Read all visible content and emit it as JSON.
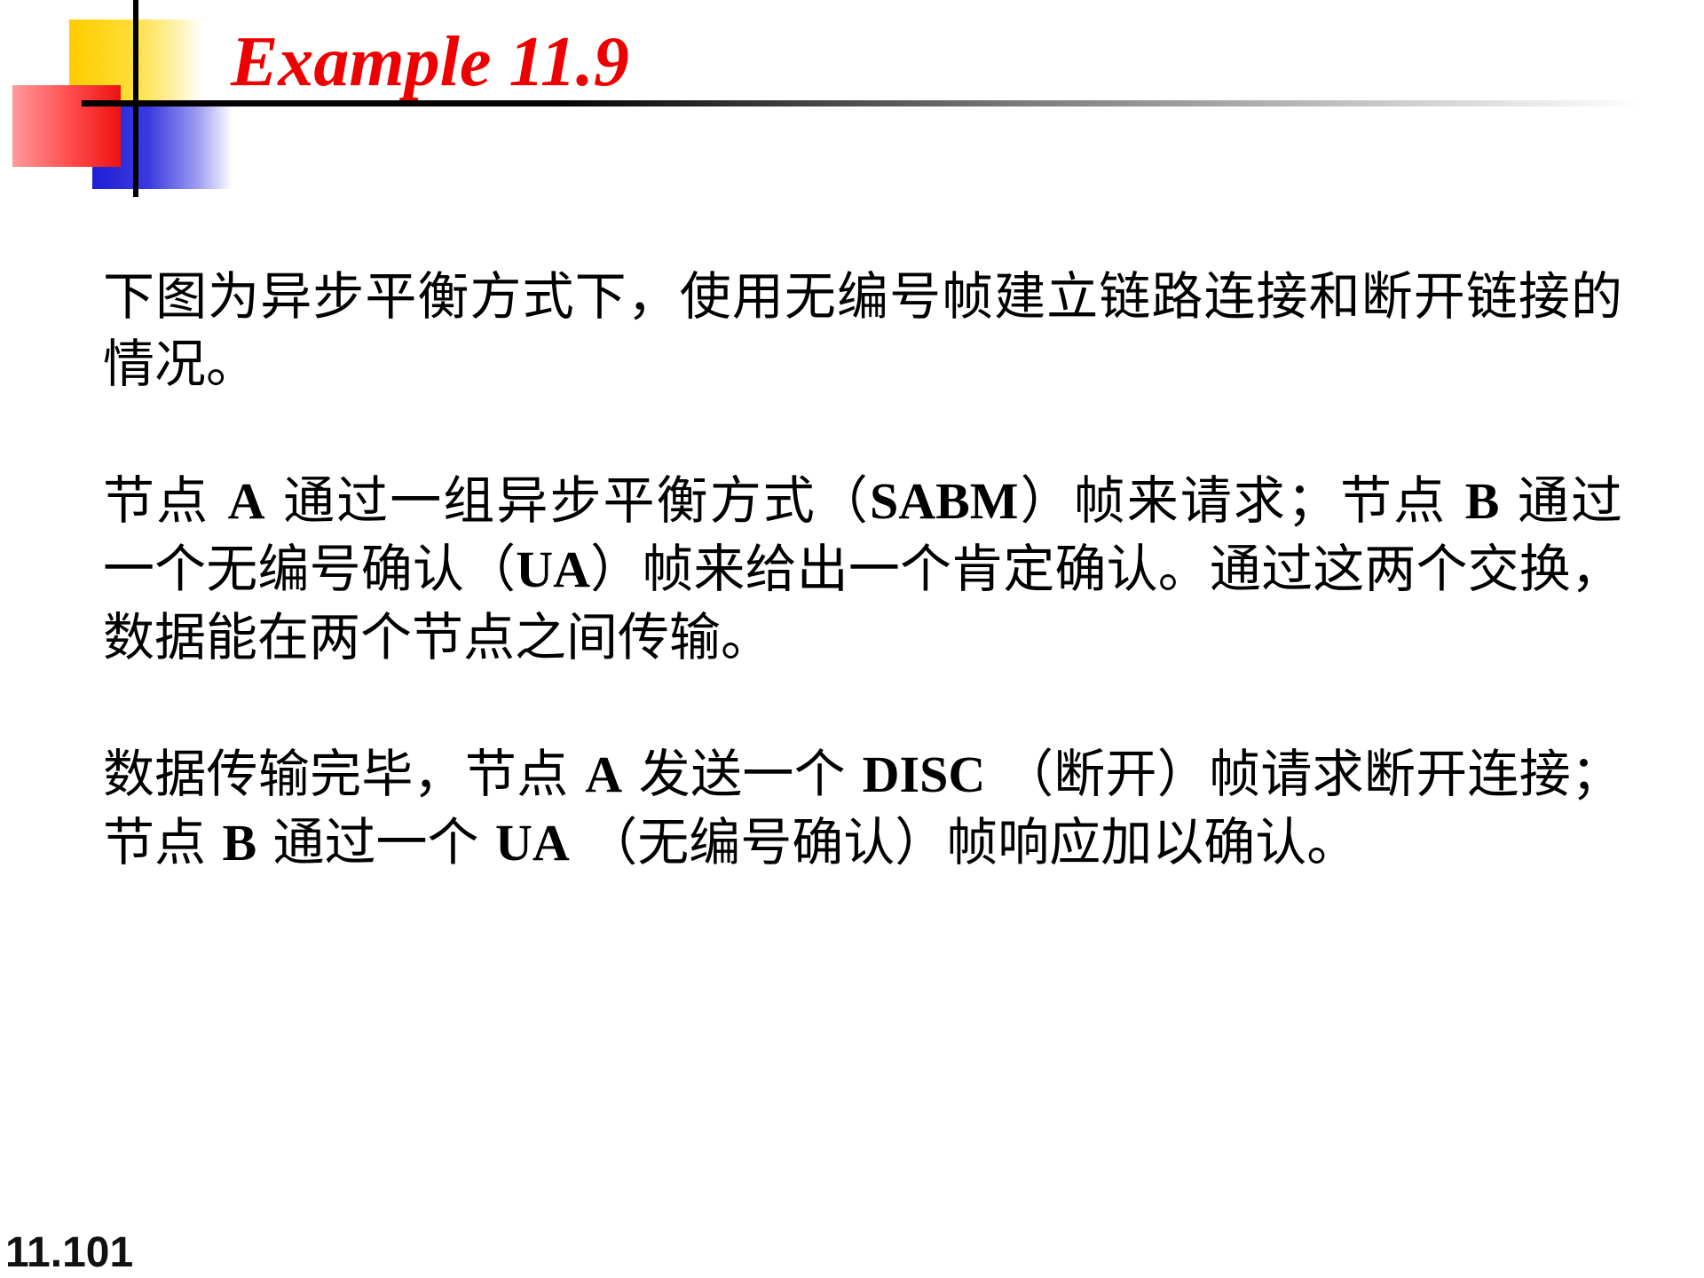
{
  "slide": {
    "title": "Example 11.9",
    "slide_number": "11.101",
    "title_color": "#ee0000",
    "decoration_colors": [
      "#ffcc00",
      "#1f1fd6",
      "#ff3333",
      "#000000"
    ]
  },
  "paragraphs": [
    {
      "segments": [
        {
          "text": "下图为异步平衡方式下，使用无编号帧建立链路连接和断开链接的情况。",
          "bold": false
        }
      ]
    },
    {
      "segments": [
        {
          "text": "节点 ",
          "bold": false
        },
        {
          "text": "A",
          "bold": true
        },
        {
          "text": " 通过一组异步平衡方式（",
          "bold": false
        },
        {
          "text": "SABM",
          "bold": true
        },
        {
          "text": "）帧来请求；节点 ",
          "bold": false
        },
        {
          "text": "B",
          "bold": true
        },
        {
          "text": " 通过一个无编号确认（",
          "bold": false
        },
        {
          "text": "UA",
          "bold": true
        },
        {
          "text": "）帧来给出一个肯定确认。通过这两个交换，数据能在两个节点之间传输。",
          "bold": false
        }
      ]
    },
    {
      "segments": [
        {
          "text": "数据传输完毕，节点 ",
          "bold": false
        },
        {
          "text": "A",
          "bold": true
        },
        {
          "text": " 发送一个 ",
          "bold": false
        },
        {
          "text": "DISC",
          "bold": true
        },
        {
          "text": " （断开）帧请求断开连接；节点 ",
          "bold": false
        },
        {
          "text": "B",
          "bold": true
        },
        {
          "text": " 通过一个 ",
          "bold": false
        },
        {
          "text": "UA",
          "bold": true
        },
        {
          "text": " （无编号确认）帧响应加以确认。",
          "bold": false
        }
      ]
    }
  ]
}
